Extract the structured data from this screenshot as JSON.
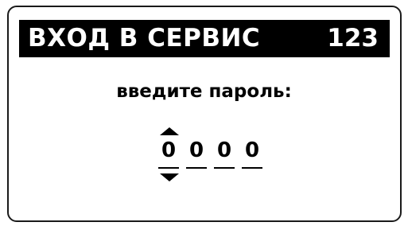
{
  "header": {
    "title": "ВХОД В СЕРВИС",
    "code": "123"
  },
  "prompt": "введите пароль:",
  "password": {
    "digits": [
      "0",
      "0",
      "0",
      "0"
    ],
    "active_index": 0
  },
  "icons": {
    "increment": "arrow-up-icon",
    "decrement": "arrow-down-icon"
  }
}
